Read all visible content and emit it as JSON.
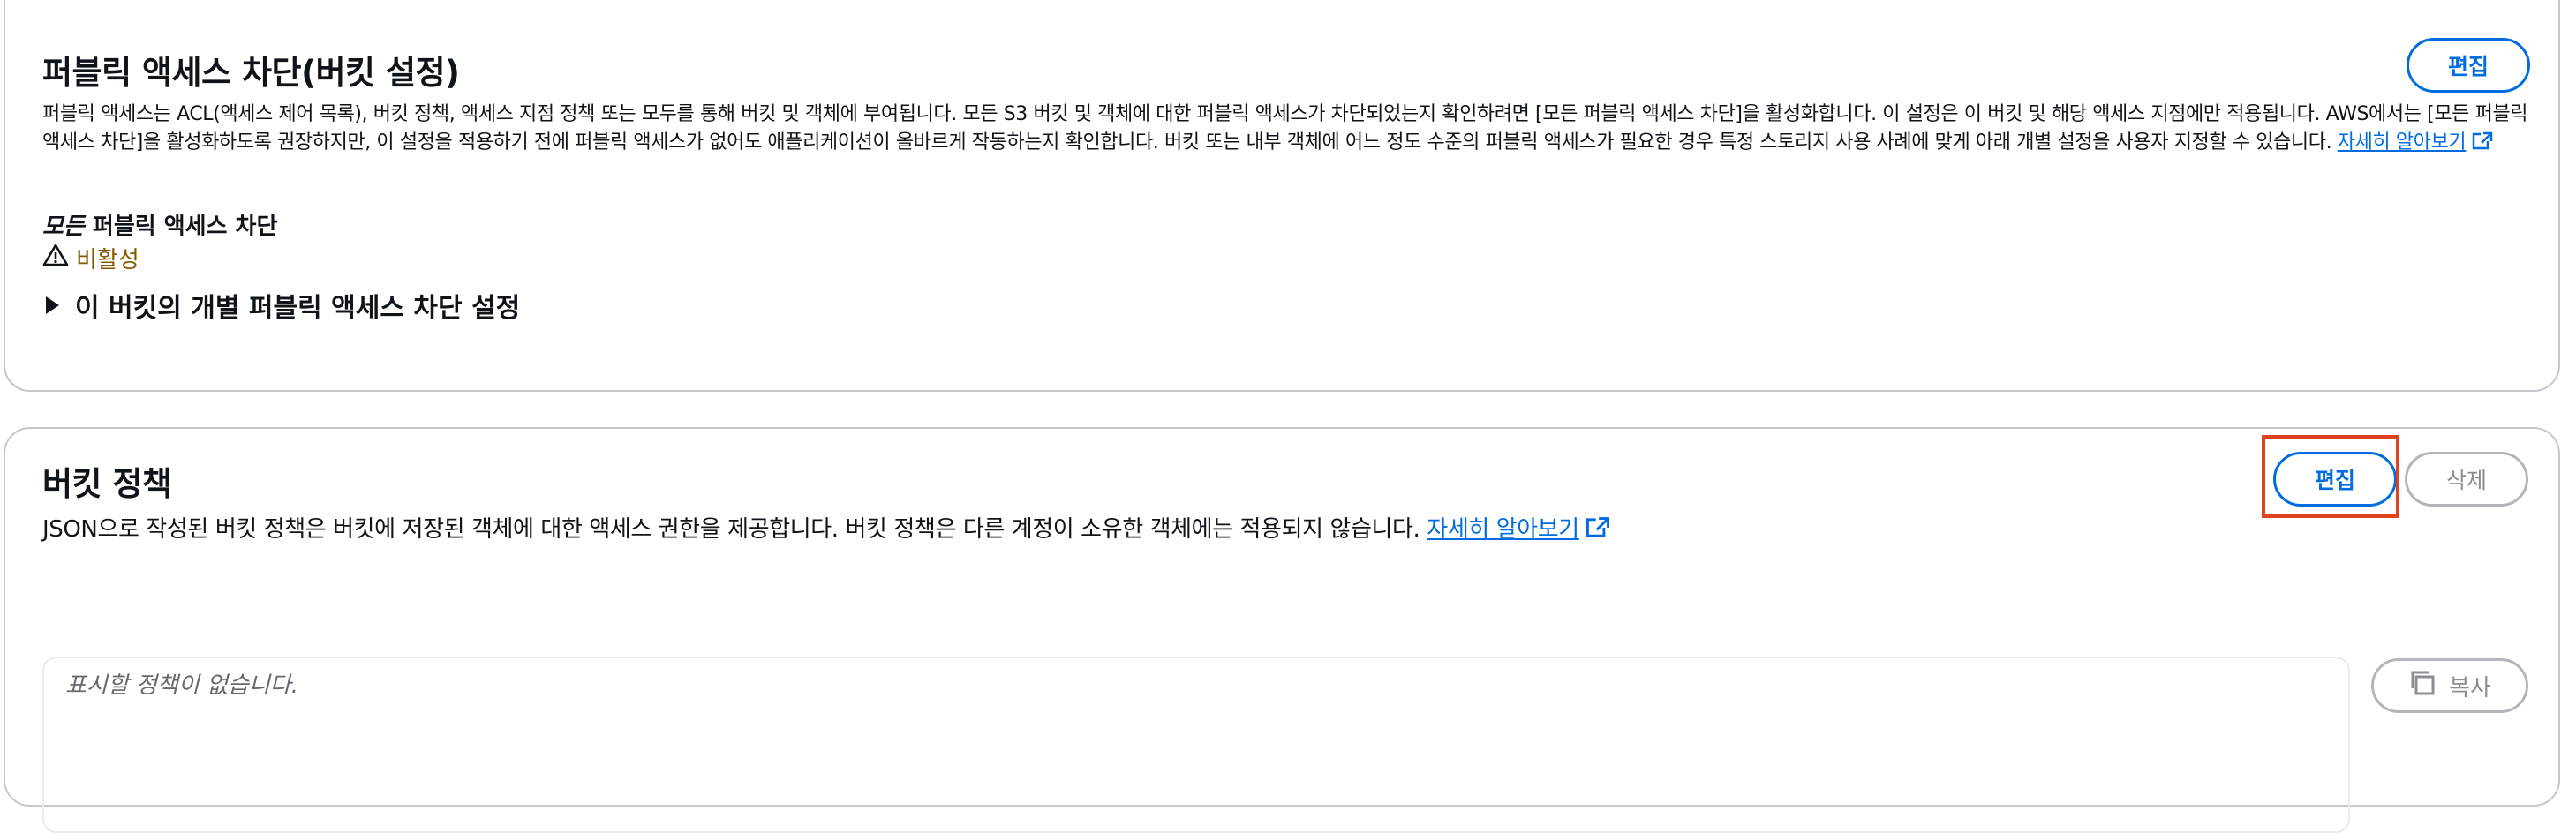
{
  "block_public_access": {
    "title": "퍼블릭 액세스 차단(버킷 설정)",
    "edit_label": "편집",
    "description": "퍼블릭 액세스는 ACL(액세스 제어 목록), 버킷 정책, 액세스 지점 정책 또는 모두를 통해 버킷 및 객체에 부여됩니다. 모든 S3 버킷 및 객체에 대한 퍼블릭 액세스가 차단되었는지 확인하려면 [모든 퍼블릭 액세스 차단]을 활성화합니다. 이 설정은 이 버킷 및 해당 액세스 지점에만 적용됩니다. AWS에서는 [모든 퍼블릭 액세스 차단]을 활성화하도록 권장하지만, 이 설정을 적용하기 전에 퍼블릭 액세스가 없어도 애플리케이션이 올바르게 작동하는지 확인합니다. 버킷 또는 내부 객체에 어느 정도 수준의 퍼블릭 액세스가 필요한 경우 특정 스토리지 사용 사례에 맞게 아래 개별 설정을 사용자 지정할 수 있습니다.",
    "learn_more": "자세히 알아보기",
    "setting_label_prefix": "모든",
    "setting_label_rest": " 퍼블릭 액세스 차단",
    "status_text": "비활성",
    "status_color": "#855900",
    "individual_settings_label": "이 버킷의 개별 퍼블릭 액세스 차단 설정"
  },
  "bucket_policy": {
    "title": "버킷 정책",
    "edit_label": "편집",
    "delete_label": "삭제",
    "description": "JSON으로 작성된 버킷 정책은 버킷에 저장된 객체에 대한 액세스 권한을 제공합니다. 버킷 정책은 다른 계정이 소유한 객체에는 적용되지 않습니다.",
    "learn_more": "자세히 알아보기",
    "empty_text": "표시할 정책이 없습니다.",
    "copy_label": "복사"
  },
  "colors": {
    "accent": "#006ce0",
    "highlight": "#e0421d",
    "border": "#c6c6cd"
  }
}
